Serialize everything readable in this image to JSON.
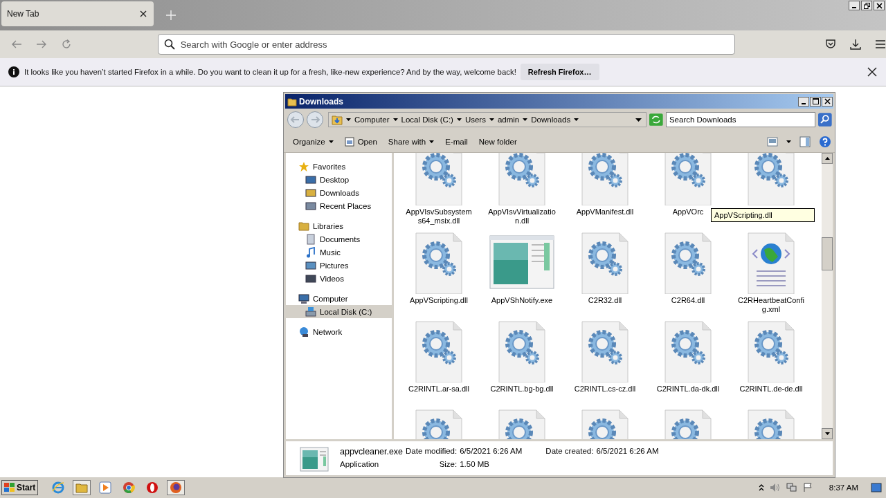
{
  "browser": {
    "tabs": [
      {
        "label": "New Tab",
        "selected": true
      }
    ],
    "address": {
      "placeholder": "Search with Google or enter address"
    },
    "notification": {
      "message": "It looks like you haven’t started Firefox in a while. Do you want to clean it up for a fresh, like-new experience? And by the way, welcome back!",
      "button": "Refresh Firefox…"
    }
  },
  "explorer": {
    "title": "Downloads",
    "breadcrumbs": [
      "Computer",
      "Local Disk (C:)",
      "Users",
      "admin",
      "Downloads"
    ],
    "search": {
      "placeholder": "Search Downloads"
    },
    "toolbar": [
      {
        "label": "Organize",
        "kind": "menu"
      },
      {
        "label": "Open",
        "kind": "open"
      },
      {
        "label": "Share with",
        "kind": "menu"
      },
      {
        "label": "E-mail",
        "kind": "plain"
      },
      {
        "label": "New folder",
        "kind": "plain"
      }
    ],
    "nav": [
      {
        "label": "Favorites",
        "kind": "star",
        "selected": false,
        "children": [
          {
            "label": "Desktop",
            "kind": "desktop",
            "selected": false
          },
          {
            "label": "Downloads",
            "kind": "downloads",
            "selected": false
          },
          {
            "label": "Recent Places",
            "kind": "recent",
            "selected": false
          }
        ]
      },
      {
        "label": "Libraries",
        "kind": "library",
        "selected": false,
        "children": [
          {
            "label": "Documents",
            "kind": "documents",
            "selected": false
          },
          {
            "label": "Music",
            "kind": "music",
            "selected": false
          },
          {
            "label": "Pictures",
            "kind": "pictures",
            "selected": false
          },
          {
            "label": "Videos",
            "kind": "videos",
            "selected": false
          }
        ]
      },
      {
        "label": "Computer",
        "kind": "computer",
        "selected": false,
        "children": [
          {
            "label": "Local Disk (C:)",
            "kind": "disk",
            "selected": true
          }
        ]
      },
      {
        "label": "Network",
        "kind": "network",
        "selected": false
      }
    ],
    "files": [
      {
        "name": "AppVIsvSubsystems64_msix.dll",
        "kind": "dll"
      },
      {
        "name": "AppVIsvVirtualization.dll",
        "kind": "dll"
      },
      {
        "name": "AppVManifest.dll",
        "kind": "dll"
      },
      {
        "name": "AppVOrc",
        "kind": "dll"
      },
      {
        "kind": "dll"
      },
      {
        "name": "AppVScripting.dll",
        "kind": "dll"
      },
      {
        "name": "AppVShNotify.exe",
        "kind": "exe"
      },
      {
        "name": "C2R32.dll",
        "kind": "dll"
      },
      {
        "name": "C2R64.dll",
        "kind": "dll"
      },
      {
        "name": "C2RHeartbeatConfig.xml",
        "kind": "xml"
      },
      {
        "name": "C2RINTL.ar-sa.dll",
        "kind": "dll"
      },
      {
        "name": "C2RINTL.bg-bg.dll",
        "kind": "dll"
      },
      {
        "name": "C2RINTL.cs-cz.dll",
        "kind": "dll"
      },
      {
        "name": "C2RINTL.da-dk.dll",
        "kind": "dll"
      },
      {
        "name": "C2RINTL.de-de.dll",
        "kind": "dll"
      },
      {
        "kind": "dll"
      },
      {
        "kind": "dll"
      },
      {
        "kind": "dll"
      },
      {
        "kind": "dll"
      },
      {
        "kind": "dll"
      }
    ],
    "tooltip": "AppVScripting.dll",
    "details": {
      "name": "appvcleaner.exe",
      "type": "Application",
      "modified_label": "Date modified:",
      "modified": "6/5/2021 6:26 AM",
      "created_label": "Date created:",
      "created": "6/5/2021 6:26 AM",
      "size_label": "Size:",
      "size": "1.50 MB"
    }
  },
  "taskbar": {
    "start": "Start",
    "apps": [
      {
        "kind": "ie",
        "selected": false
      },
      {
        "kind": "explorer",
        "selected": true
      },
      {
        "kind": "media",
        "selected": false
      },
      {
        "kind": "chrome",
        "selected": false
      },
      {
        "kind": "opera",
        "selected": false
      },
      {
        "kind": "firefox",
        "selected": true
      }
    ],
    "clock": "8:37 AM"
  }
}
